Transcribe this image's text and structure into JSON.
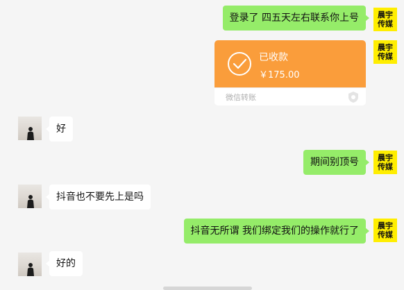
{
  "avatar_me": {
    "line1": "晨宇",
    "line2": "传媒"
  },
  "messages": [
    {
      "side": "me",
      "text": "登录了 四五天左右联系你上号"
    },
    {
      "side": "me",
      "type": "transfer",
      "status": "已收款",
      "amount": "￥175.00",
      "label": "微信转账"
    },
    {
      "side": "them",
      "text": "好"
    },
    {
      "side": "me",
      "text": "期间别顶号"
    },
    {
      "side": "them",
      "text": "抖音也不要先上是吗"
    },
    {
      "side": "me",
      "text": "抖音无所谓 我们绑定我们的操作就行了"
    },
    {
      "side": "them",
      "text": "好的"
    }
  ],
  "colors": {
    "me_bubble": "#95ec69",
    "them_bubble": "#ffffff",
    "transfer": "#fa9d3b",
    "background": "#f5f5f5"
  }
}
